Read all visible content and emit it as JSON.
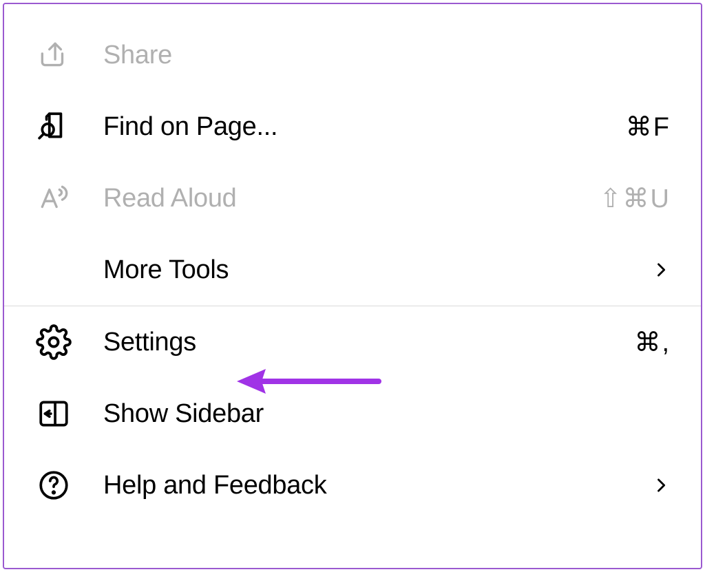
{
  "menu": {
    "items": [
      {
        "id": "share",
        "label": "Share",
        "shortcut": "",
        "disabled": true,
        "submenu": false
      },
      {
        "id": "find",
        "label": "Find on Page...",
        "shortcut": "⌘F",
        "disabled": false,
        "submenu": false
      },
      {
        "id": "read-aloud",
        "label": "Read Aloud",
        "shortcut": "⇧⌘U",
        "disabled": true,
        "submenu": false
      },
      {
        "id": "more-tools",
        "label": "More Tools",
        "shortcut": "",
        "disabled": false,
        "submenu": true
      },
      {
        "id": "settings",
        "label": "Settings",
        "shortcut": "⌘,",
        "disabled": false,
        "submenu": false
      },
      {
        "id": "show-sidebar",
        "label": "Show Sidebar",
        "shortcut": "",
        "disabled": false,
        "submenu": false
      },
      {
        "id": "help",
        "label": "Help and Feedback",
        "shortcut": "",
        "disabled": false,
        "submenu": true
      }
    ]
  },
  "annotation": {
    "target": "settings",
    "color": "#a033e6"
  }
}
